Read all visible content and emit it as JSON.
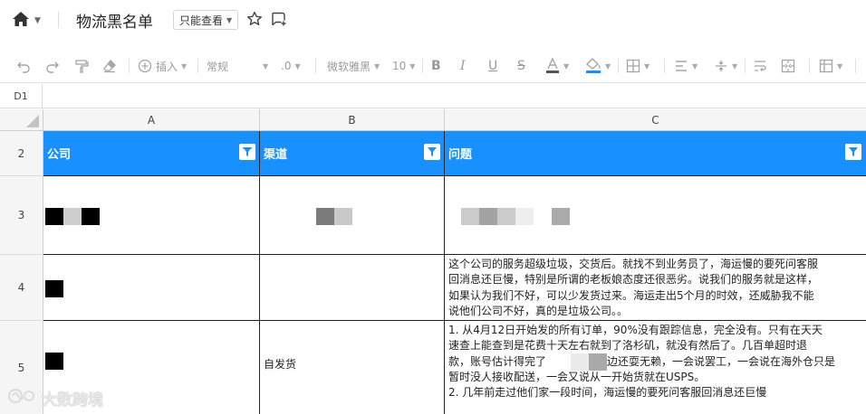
{
  "header": {
    "doc_title": "物流黑名单",
    "mode_label": "只能查看"
  },
  "toolbar": {
    "insert_label": "插入",
    "format_label": "常规",
    "decimal_label": ".0",
    "font_label": "微软雅黑",
    "font_size_label": "10"
  },
  "formula_bar": {
    "cell_ref": "D1"
  },
  "grid": {
    "columns": [
      "A",
      "B",
      "C"
    ],
    "rows": [
      "2",
      "3",
      "4",
      "5"
    ],
    "header_row": {
      "col_a": "公司",
      "col_b": "渠道",
      "col_c": "问题",
      "fill_color": "#1890ff"
    },
    "row_3": {
      "a": "",
      "b": "",
      "c": ""
    },
    "row_4": {
      "a": "",
      "b": "",
      "c_lines": [
        "这个公司的服务超级垃圾，交货后。就找不到业务员了，海运慢的要死问客服",
        "回消息还巨慢，特别是所谓的老板娘态度还很恶劣。说我们的服务就是这样，",
        "如果认为我们不好，可以少发货过来。海运走出5个月的时效，还威胁我不能",
        "说他们公司不好，真的是垃圾公司。。"
      ]
    },
    "row_5": {
      "a": "",
      "b": "自发货",
      "c_lines": [
        "1. 从4月12日开始发的所有订单，90%没有跟踪信息，完全没有。只有在天天",
        "速查上能查到是花费十天左右就到了洛杉矶，就没有然后了。几百单超时退",
        "款，账号估计得完了",
        "边还耍无赖，一会说罢工，一会说在海外仓只是",
        "暂时没人接收配送，一会又说从一开始货就在USPS。",
        "2. 几年前走过他们家一段时间，海运慢的要死问客服回消息还巨慢"
      ]
    }
  },
  "watermark": {
    "text": "大数跨境"
  }
}
